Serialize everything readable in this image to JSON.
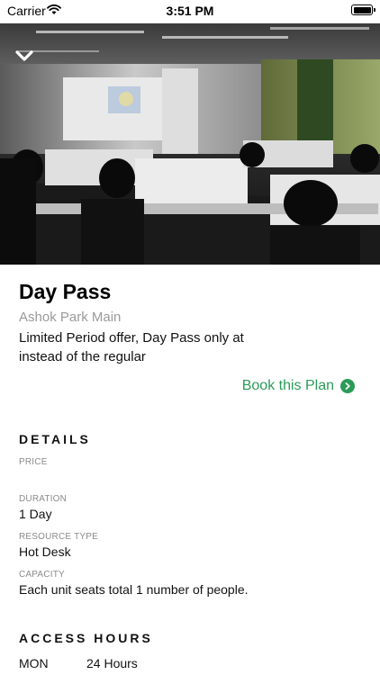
{
  "status_bar": {
    "carrier": "Carrier",
    "time": "3:51 PM"
  },
  "hero": {
    "image_description_icon": "office-photo"
  },
  "plan": {
    "title": "Day Pass",
    "location": "Ashok Park Main",
    "description": "Limited Period offer, Day Pass only at instead of the regular",
    "book_label": "Book this Plan"
  },
  "details": {
    "heading": "DETAILS",
    "price_label": "PRICE",
    "price_value": "",
    "duration_label": "DURATION",
    "duration_value": "1 Day",
    "resource_type_label": "RESOURCE TYPE",
    "resource_type_value": "Hot Desk",
    "capacity_label": "CAPACITY",
    "capacity_value": "Each unit seats total 1 number of people."
  },
  "access_hours": {
    "heading": "ACCESS HOURS",
    "rows": [
      {
        "day": "MON",
        "hours": "24 Hours"
      }
    ]
  },
  "colors": {
    "accent_green": "#2a9c58"
  }
}
